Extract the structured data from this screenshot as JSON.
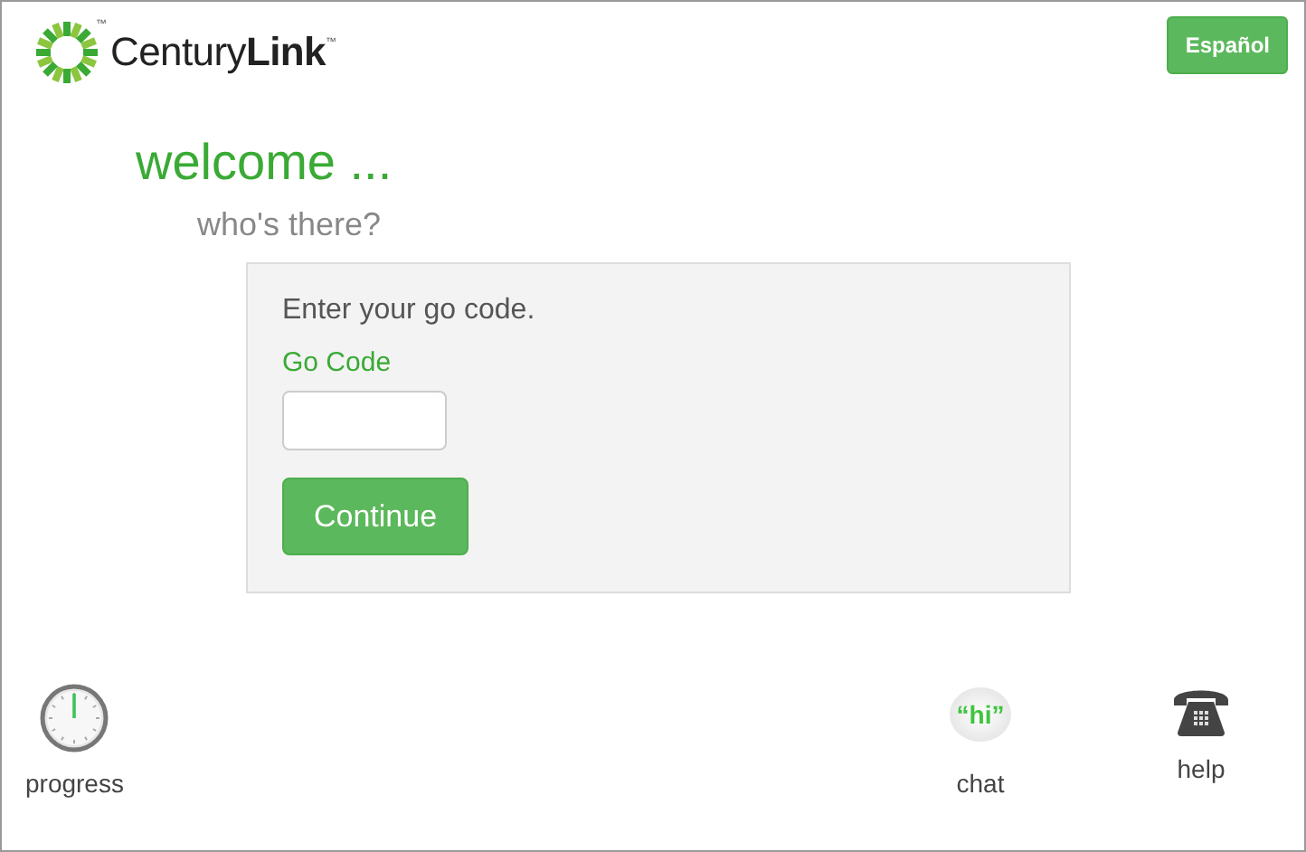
{
  "header": {
    "logo_text": "Century**Link**",
    "logo_tm": "™",
    "mark_tm": "™",
    "language_button": "Español"
  },
  "welcome": {
    "title": "welcome ...",
    "subtitle": "who's there?"
  },
  "form": {
    "prompt": "Enter your go code.",
    "field_label": "Go Code",
    "button": "Continue"
  },
  "footer": [
    {
      "kind": "progress",
      "label": "progress"
    },
    {
      "kind": "chat",
      "label": "chat",
      "bubble_text": "“hi”"
    },
    {
      "kind": "help",
      "label": "help"
    }
  ]
}
